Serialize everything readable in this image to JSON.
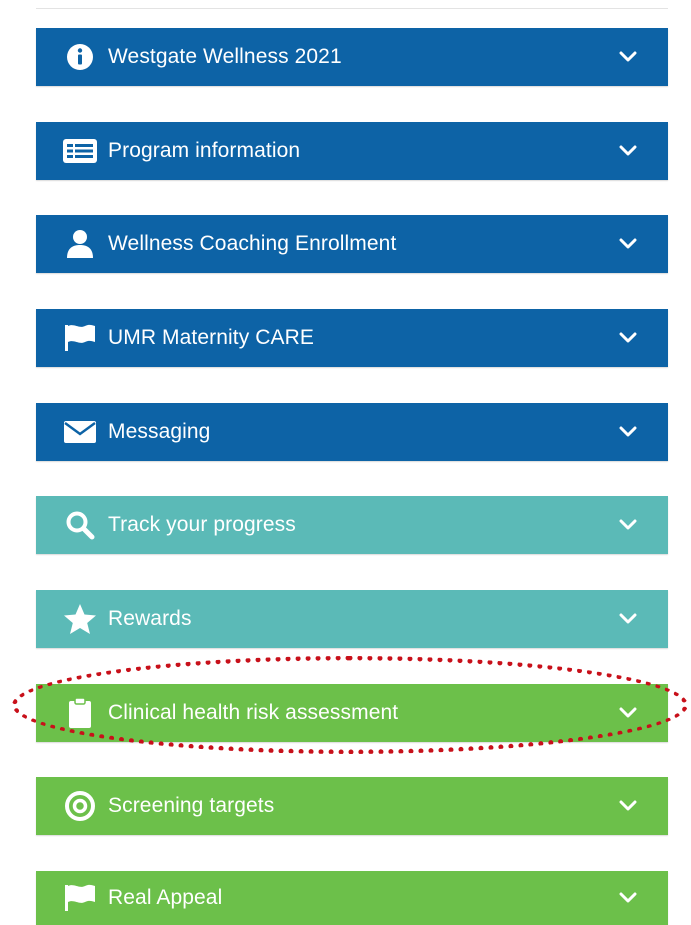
{
  "colors": {
    "blue": "#0d63a6",
    "teal": "#5bbab7",
    "green": "#6cc04a",
    "highlight": "#c8101a"
  },
  "sections": [
    {
      "label": "Westgate Wellness 2021",
      "icon": "info-icon",
      "color": "blue"
    },
    {
      "label": "Program information",
      "icon": "list-card-icon",
      "color": "blue"
    },
    {
      "label": "Wellness Coaching Enrollment",
      "icon": "user-icon",
      "color": "blue"
    },
    {
      "label": "UMR Maternity CARE",
      "icon": "flag-icon",
      "color": "blue"
    },
    {
      "label": "Messaging",
      "icon": "envelope-icon",
      "color": "blue"
    },
    {
      "label": "Track your progress",
      "icon": "search-icon",
      "color": "teal"
    },
    {
      "label": "Rewards",
      "icon": "star-icon",
      "color": "teal"
    },
    {
      "label": "Clinical health risk assessment",
      "icon": "clipboard-icon",
      "color": "green",
      "highlighted": true
    },
    {
      "label": "Screening targets",
      "icon": "target-icon",
      "color": "green"
    },
    {
      "label": "Real Appeal",
      "icon": "flag-icon",
      "color": "green"
    }
  ]
}
